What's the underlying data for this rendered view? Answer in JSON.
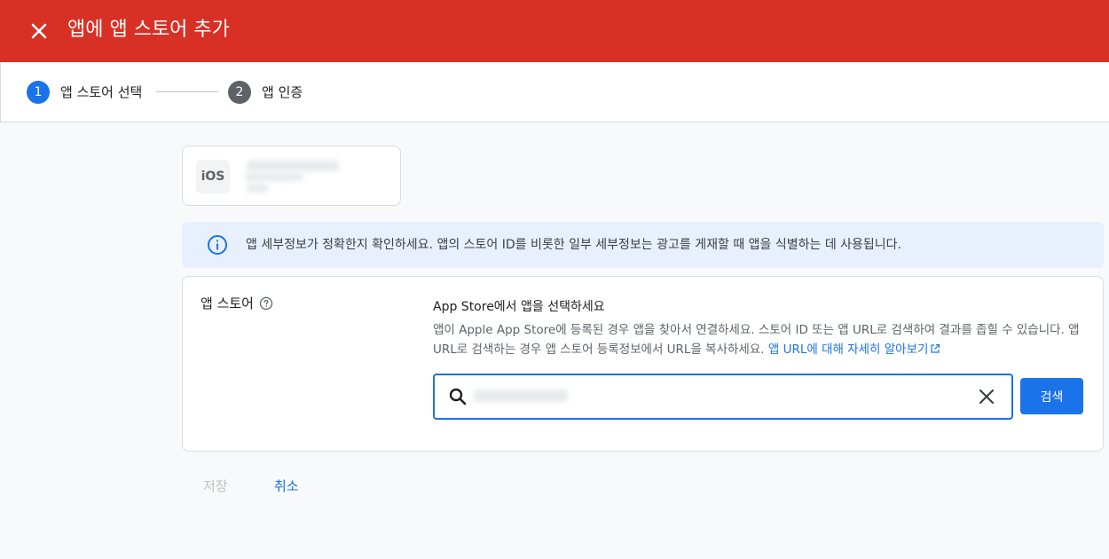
{
  "header": {
    "title": "앱에 앱 스토어 추가",
    "close_icon": "close-icon",
    "bg_color": "#d93025"
  },
  "stepper": {
    "steps": [
      {
        "number": "1",
        "label": "앱 스토어 선택",
        "state": "active"
      },
      {
        "number": "2",
        "label": "앱 인증",
        "state": "inactive"
      }
    ]
  },
  "app_card": {
    "platform_badge": "iOS"
  },
  "info_banner": {
    "icon": "info-icon",
    "text": "앱 세부정보가 정확한지 확인하세요. 앱의 스토어 ID를 비롯한 일부 세부정보는 광고를 게재할 때 앱을 식별하는 데 사용됩니다."
  },
  "form": {
    "field_label": "앱 스토어",
    "help_icon": "help-icon",
    "section_title": "App Store에서 앱을 선택하세요",
    "section_desc": "앱이 Apple App Store에 등록된 경우 앱을 찾아서 연결하세요. 스토어 ID 또는 앱 URL로 검색하여 결과를 좁힐 수 있습니다. 앱 URL로 검색하는 경우 앱 스토어 등록정보에서 URL을 복사하세요.",
    "learn_more_link": "앱 URL에 대해 자세히 알아보기",
    "search": {
      "value": "",
      "placeholder": ""
    },
    "search_button": "검색"
  },
  "footer": {
    "save_label": "저장",
    "cancel_label": "취소"
  }
}
